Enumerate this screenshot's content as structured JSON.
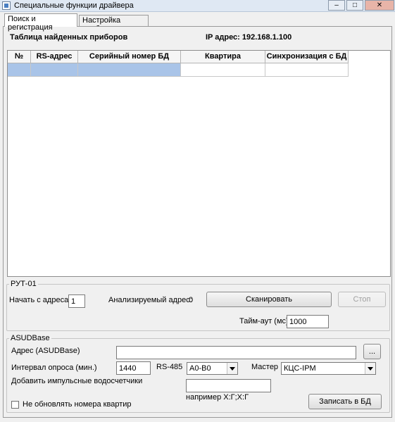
{
  "window": {
    "title": "Специальные функции драйвера"
  },
  "tabs": [
    {
      "label": "Поиск и регистрация",
      "active": true
    },
    {
      "label": "Настройка прибора",
      "active": false
    }
  ],
  "search": {
    "table_title": "Таблица найденных приборов",
    "ip_label": "IP адрес: 192.168.1.100",
    "columns": [
      "№",
      "RS-адрес",
      "Серийный номер БД",
      "Квартира",
      "Синхронизация с БД"
    ]
  },
  "rut": {
    "group_label": "РУТ-01",
    "start_label": "Начать с адреса",
    "start_value": "1",
    "analyzed_label": "Анализируемый адрес:",
    "analyzed_value": "0",
    "scan_label": "Сканировать",
    "stop_label": "Стоп",
    "timeout_label": "Тайм-аут (мс)",
    "timeout_value": "1000"
  },
  "asud": {
    "group_label": "ASUDBase",
    "address_label": "Адрес (ASUDBase)",
    "address_value": "",
    "browse_label": "...",
    "interval_label": "Интервал опроса (мин.)",
    "interval_value": "1440",
    "rs485_label": "RS-485",
    "rs485_value": "A0-B0",
    "master_label": "Мастер",
    "master_value": "КЦС-IPM",
    "add_meters_label": "Добавить импульсные водосчетчики",
    "add_meters_value": "",
    "example_label": "например Х:Г;Х:Г",
    "no_update_label": "Не обновлять номера квартир",
    "no_update_checked": false,
    "save_label": "Записать в БД"
  }
}
